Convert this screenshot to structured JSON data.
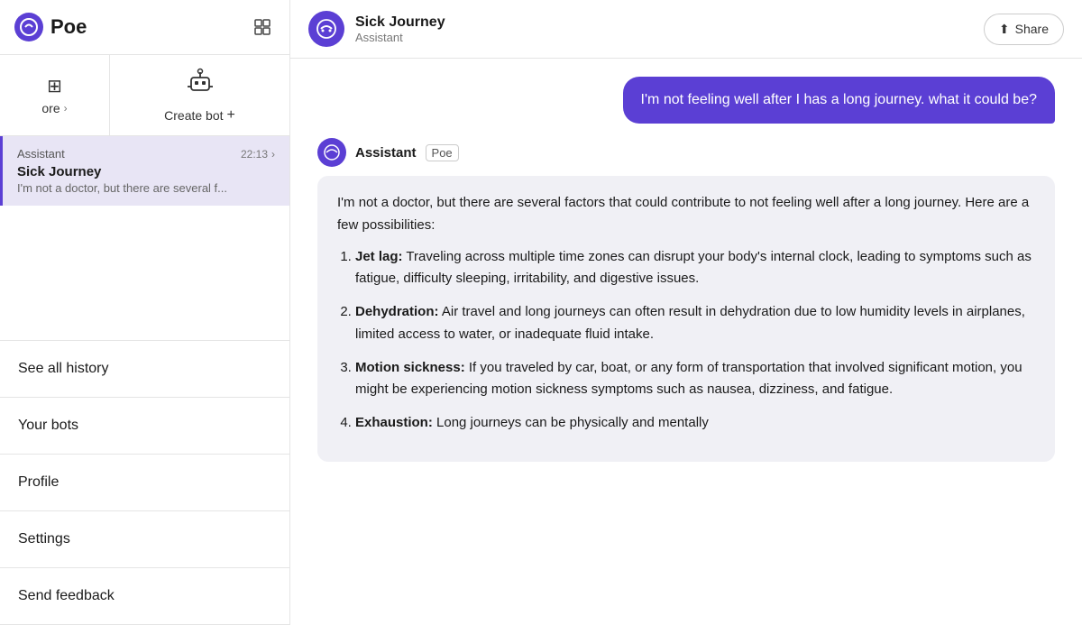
{
  "app": {
    "name": "Poe"
  },
  "sidebar": {
    "logo": "Poe",
    "explore_label": "ore",
    "explore_more_label": "More",
    "create_bot_label": "Create bot",
    "chat_item": {
      "bot": "Assistant",
      "time": "22:13",
      "title": "Sick Journey",
      "preview": "I'm not a doctor, but there are several f..."
    },
    "see_all_history": "See all history",
    "your_bots": "Your bots",
    "profile": "Profile",
    "settings": "Settings",
    "send_feedback": "Send feedback"
  },
  "chat": {
    "bot_name": "Sick Journey",
    "bot_subtitle": "Assistant",
    "share_label": "Share",
    "user_message": "I'm not feeling well after I has a long journey. what it could be?",
    "assistant_label": "Assistant",
    "poe_label": "Poe",
    "response_intro": "I'm not a doctor, but there are several factors that could contribute to not feeling well after a long journey. Here are a few possibilities:",
    "items": [
      {
        "title": "Jet lag:",
        "text": "Traveling across multiple time zones can disrupt your body's internal clock, leading to symptoms such as fatigue, difficulty sleeping, irritability, and digestive issues."
      },
      {
        "title": "Dehydration:",
        "text": "Air travel and long journeys can often result in dehydration due to low humidity levels in airplanes, limited access to water, or inadequate fluid intake."
      },
      {
        "title": "Motion sickness:",
        "text": "If you traveled by car, boat, or any form of transportation that involved significant motion, you might be experiencing motion sickness symptoms such as nausea, dizziness, and fatigue."
      },
      {
        "title": "Exhaustion:",
        "text": "Long journeys can be physically and mentally"
      }
    ]
  }
}
